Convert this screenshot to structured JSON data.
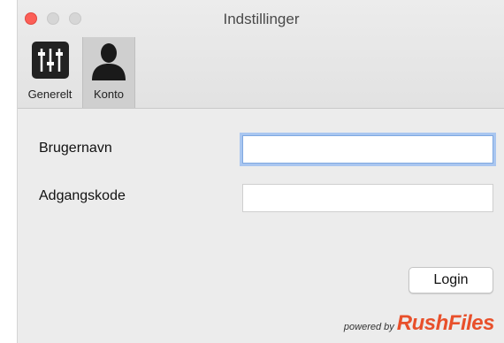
{
  "window": {
    "title": "Indstillinger"
  },
  "toolbar": {
    "items": [
      {
        "label": "Generelt",
        "icon": "sliders-icon",
        "selected": false
      },
      {
        "label": "Konto",
        "icon": "user-icon",
        "selected": true
      }
    ]
  },
  "form": {
    "username_label": "Brugernavn",
    "username_value": "",
    "password_label": "Adgangskode",
    "password_value": "",
    "login_label": "Login"
  },
  "brand": {
    "powered_text": "powered by",
    "name": "RushFiles",
    "color": "#e8502b"
  },
  "colors": {
    "close": "#fc5f57",
    "focus": "#a9c6f0"
  }
}
